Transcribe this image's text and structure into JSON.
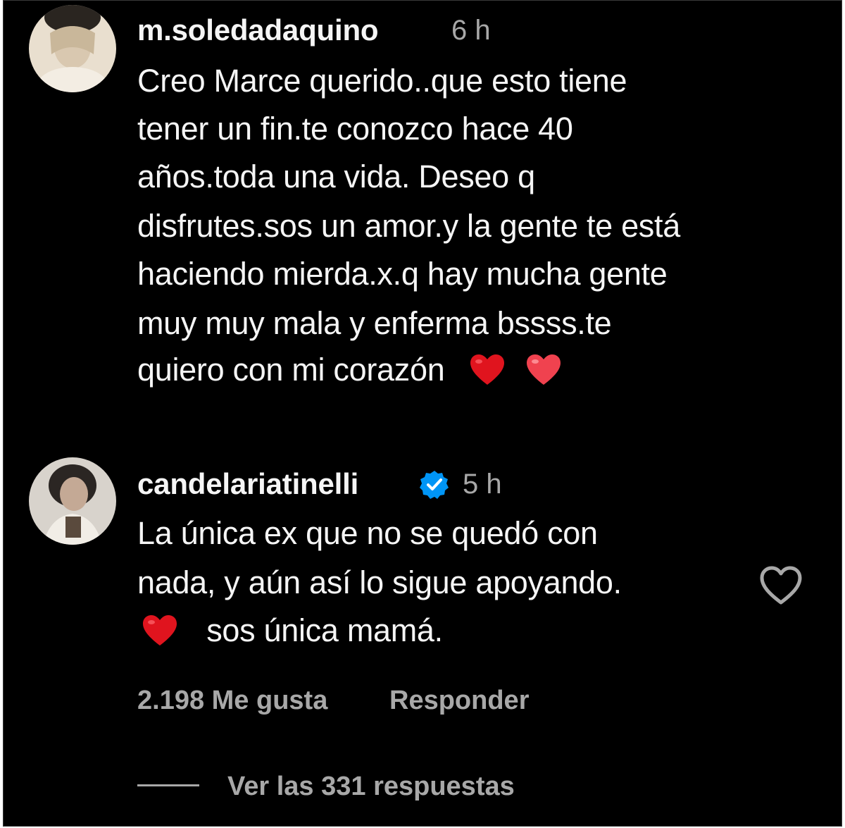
{
  "comments": [
    {
      "username": "m.soledadaquino",
      "time": "6 h",
      "lines": [
        "Creo Marce querido..que esto tiene",
        "tener un fin.te conozco hace 40",
        "años.toda una vida.  Deseo q",
        "disfrutes.sos un amor.y la gente te está",
        "haciendo mierda.x.q hay mucha gente",
        "muy muy mala y enferma bssss.te",
        "quiero con mi corazón"
      ]
    },
    {
      "username": "candelariatinelli",
      "time": "5 h",
      "verified": true,
      "lines": [
        "La única ex que no se quedó con",
        "nada, y aún así lo sigue apoyando.",
        "sos única mamá."
      ],
      "likes": "2.198 Me gusta",
      "reply_label": "Responder",
      "view_replies": "Ver las 331 respuestas"
    }
  ],
  "colors": {
    "background": "#000000",
    "text": "#f5f5f5",
    "muted": "#a8a8a8",
    "verified": "#0095f6",
    "heart_red": "#e0141e",
    "heart_pink": "#f0424f"
  },
  "icons": [
    "red-heart-emoji",
    "verified-badge-icon",
    "heart-outline-icon"
  ]
}
